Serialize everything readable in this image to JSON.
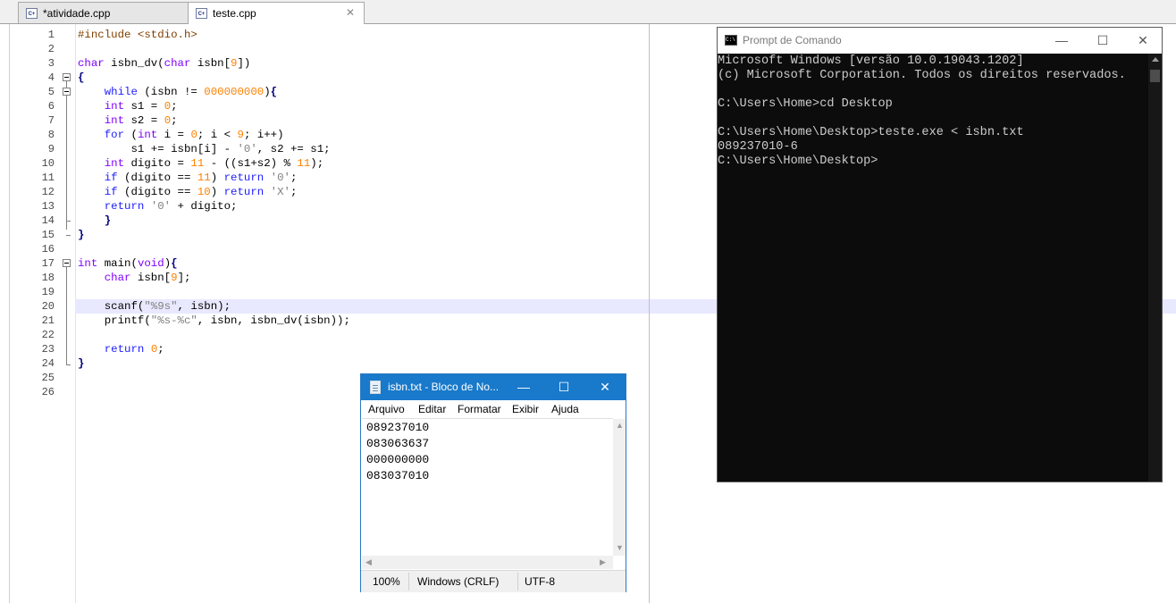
{
  "tabs": [
    {
      "label": "*atividade.cpp",
      "icon": "cpp-file-icon",
      "active": false
    },
    {
      "label": "teste.cpp",
      "icon": "cpp-file-icon",
      "active": true,
      "close": "✕"
    }
  ],
  "editor": {
    "line_numbers": [
      "1",
      "2",
      "3",
      "4",
      "5",
      "6",
      "7",
      "8",
      "9",
      "10",
      "11",
      "12",
      "13",
      "14",
      "15",
      "16",
      "17",
      "18",
      "19",
      "20",
      "21",
      "22",
      "23",
      "24",
      "25",
      "26"
    ],
    "current_line": "20"
  },
  "cmd": {
    "title": "Prompt de Comando",
    "icon": "cmd-icon",
    "icon_text": "C:\\",
    "minimize": "—",
    "maximize": "☐",
    "close": "✕",
    "lines": [
      "Microsoft Windows [versão 10.0.19043.1202]",
      "(c) Microsoft Corporation. Todos os direitos reservados.",
      "",
      "C:\\Users\\Home>cd Desktop",
      "",
      "C:\\Users\\Home\\Desktop>teste.exe < isbn.txt",
      "089237010-6",
      "C:\\Users\\Home\\Desktop>"
    ]
  },
  "notepad": {
    "title": "isbn.txt - Bloco de No...",
    "icon": "notepad-icon",
    "minimize": "—",
    "maximize": "☐",
    "close": "✕",
    "menu": [
      "Arquivo",
      "Editar",
      "Formatar",
      "Exibir",
      "Ajuda"
    ],
    "lines": [
      "089237010",
      "083063637",
      "000000000",
      "083037010"
    ],
    "status": {
      "zoom": "100%",
      "line_ending": "Windows (CRLF)",
      "encoding": "UTF-8"
    }
  },
  "colors": {
    "keyword": "#2020ff",
    "type": "#8000ff",
    "number": "#ff8000",
    "string": "#808080",
    "preprocessor": "#804000",
    "notepad_title": "#1979ca",
    "cmd_background": "#0c0c0c"
  }
}
